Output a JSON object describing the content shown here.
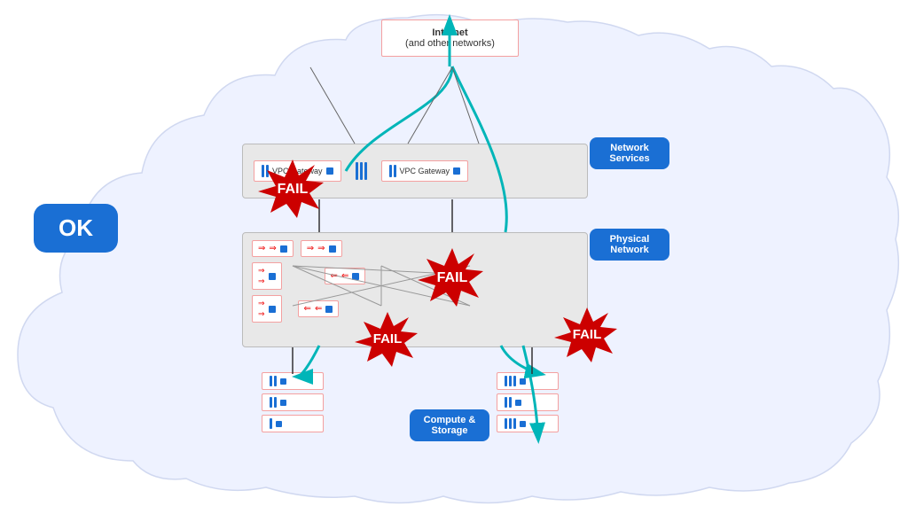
{
  "internet": {
    "label": "Internet",
    "sublabel": "(and other networks)"
  },
  "ok_badge": "OK",
  "labels": {
    "network_services": "Network Services",
    "physical_network": "Physical Network",
    "compute_storage": "Compute & Storage"
  },
  "vpc_gateway": "VPC Gateway",
  "fail": "FAIL",
  "colors": {
    "teal": "#00b5b8",
    "blue": "#1a6fd4",
    "red": "#cc0000",
    "pink_border": "#f4a0a0",
    "gray_bg": "#e8e8e8",
    "cloud_bg": "#f0f4ff"
  }
}
